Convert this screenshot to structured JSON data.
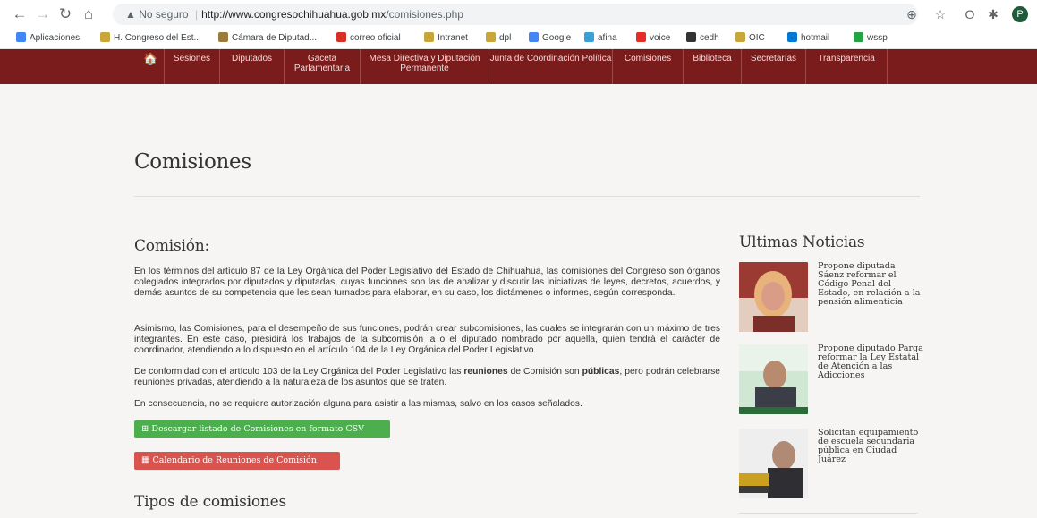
{
  "browser": {
    "security_label": "No seguro",
    "url_host": "http://www.congresochihuahua.gob.mx",
    "url_path": "/comisiones.php",
    "bookmarks": [
      {
        "label": "Aplicaciones",
        "color": "#4285f4"
      },
      {
        "label": "H. Congreso del Est...",
        "color": "#c9a63a"
      },
      {
        "label": "Cámara de Diputad...",
        "color": "#9b7a3b"
      },
      {
        "label": "correo oficial",
        "color": "#d93025"
      },
      {
        "label": "Intranet",
        "color": "#c9a63a"
      },
      {
        "label": "dpl",
        "color": "#c9a63a"
      },
      {
        "label": "Google",
        "color": "#4285f4"
      },
      {
        "label": "afina",
        "color": "#3aa0d8"
      },
      {
        "label": "voice",
        "color": "#e52d27"
      },
      {
        "label": "cedh",
        "color": "#333333"
      },
      {
        "label": "OIC",
        "color": "#c9a63a"
      },
      {
        "label": "hotmail",
        "color": "#0078d4"
      },
      {
        "label": "wssp",
        "color": "#25a244"
      }
    ],
    "avatar_letter": "P"
  },
  "nav": {
    "items": [
      {
        "label": "Sesiones"
      },
      {
        "label": "Diputados"
      },
      {
        "label": "Gaceta Parlamentaria"
      },
      {
        "label": "Mesa Directiva y Diputación Permanente"
      },
      {
        "label": "Junta de Coordinación Política"
      },
      {
        "label": "Comisiones"
      },
      {
        "label": "Biblioteca"
      },
      {
        "label": "Secretarías"
      },
      {
        "label": "Transparencia"
      }
    ]
  },
  "page": {
    "title": "Comisiones",
    "section_heading": "Comisión:",
    "paragraph_1": "En los términos del artículo 87 de la Ley Orgánica del Poder Legislativo del Estado de Chihuahua, las comisiones del Congreso son órganos colegiados integrados por diputados y diputadas, cuyas funciones son las de analizar y discutir las iniciativas de leyes, decretos, acuerdos, y demás asuntos de su competencia que les sean turnados para elaborar, en su caso, los dictámenes o informes, según corresponda.",
    "paragraph_2": "Asimismo, las Comisiones, para el desempeño de sus funciones, podrán crear subcomisiones, las cuales se integrarán con un máximo de tres integrantes. En este caso, presidirá los trabajos de la subcomisión la o el diputado nombrado por aquella, quien tendrá el carácter de coordinador, atendiendo a lo dispuesto en el artículo 104 de la Ley Orgánica del Poder Legislativo.",
    "paragraph_3_pre": "De conformidad con el artículo 103 de la Ley Orgánica del Poder Legislativo las ",
    "paragraph_3_bold1": "reuniones",
    "paragraph_3_mid": " de Comisión son ",
    "paragraph_3_bold2": "públicas",
    "paragraph_3_post": ", pero podrán celebrarse reuniones privadas, atendiendo a la naturaleza de los asuntos que se traten.",
    "paragraph_4": "En consecuencia, no se requiere autorización alguna para asistir a las mismas, salvo en los casos señalados.",
    "csv_button": "Descargar listado de Comisiones en formato CSV",
    "calendar_button": "Calendario de Reuniones de Comisión",
    "types_heading": "Tipos de comisiones"
  },
  "news": {
    "heading": "Ultimas Noticias",
    "items": [
      {
        "title": "Propone diputada Sáenz reformar el Código Penal del Estado, en relación a la pensión alimenticia"
      },
      {
        "title": "Propone diputado Parga reformar la Ley Estatal de Atención a las Adicciones"
      },
      {
        "title": "Solicitan equipamiento de escuela secundaria pública en Ciudad Juárez"
      }
    ]
  },
  "colors": {
    "nav_bg": "#7b1c1c",
    "csv_button": "#4cae4c",
    "calendar_button": "#d9534f"
  }
}
